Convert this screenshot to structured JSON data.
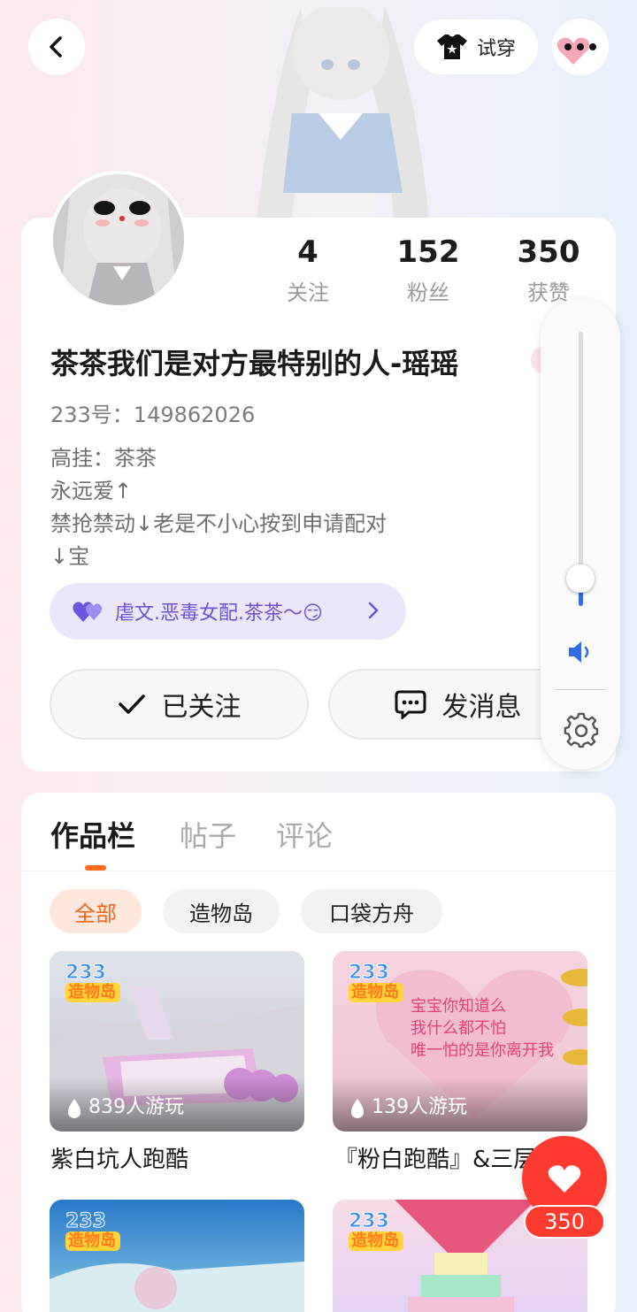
{
  "header": {
    "try_on_label": "试穿"
  },
  "profile": {
    "stats": [
      {
        "value": "4",
        "label": "关注"
      },
      {
        "value": "152",
        "label": "粉丝"
      },
      {
        "value": "350",
        "label": "获赞"
      }
    ],
    "name": "茶茶我们是对方最特别的人-瑶瑶",
    "uid": "233号：149862026",
    "bio": [
      "高挂：茶茶",
      "永远爱↑",
      "禁抢禁动↓老是不小心按到申请配对",
      "↓宝"
    ],
    "tag": "虐文.恶毒女配.茶茶～😏",
    "follow_label": "已关注",
    "message_label": "发消息"
  },
  "volume": {
    "level": 0.1
  },
  "works": {
    "tabs": [
      "作品栏",
      "帖子",
      "评论"
    ],
    "filters": [
      "全部",
      "造物岛",
      "口袋方舟"
    ],
    "logo": {
      "top": "233",
      "bottom": "造物岛"
    },
    "items": [
      {
        "plays": "839人游玩",
        "title": "紫白坑人跑酷"
      },
      {
        "plays": "139人游玩",
        "title": "『粉白跑酷』&三层",
        "banner": [
          "宝宝你知道么",
          "我什么都不怕",
          "唯一怕的是你离开我"
        ]
      }
    ]
  },
  "like_fab": {
    "count": "350"
  },
  "colors": {
    "accent": "#ff6a1f",
    "like": "#ff3b30",
    "tag_purple": "#6d52d8",
    "volume_blue": "#2f6ce8"
  }
}
